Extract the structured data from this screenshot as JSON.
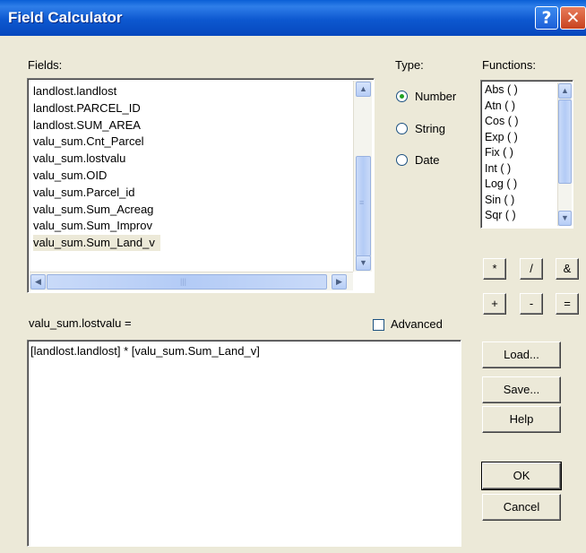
{
  "window": {
    "title": "Field Calculator"
  },
  "titlebar": {
    "help_glyph": "?",
    "close_glyph": "✕"
  },
  "fields": {
    "label": "Fields:",
    "items": [
      "landlost.landlost",
      "landlost.PARCEL_ID",
      "landlost.SUM_AREA",
      "valu_sum.Cnt_Parcel",
      "valu_sum.lostvalu",
      "valu_sum.OID",
      "valu_sum.Parcel_id",
      "valu_sum.Sum_Acreag",
      "valu_sum.Sum_Improv",
      "valu_sum.Sum_Land_v"
    ],
    "selected": "valu_sum.Sum_Land_v"
  },
  "type": {
    "label": "Type:",
    "options": [
      "Number",
      "String",
      "Date"
    ],
    "selected": "Number"
  },
  "functions": {
    "label": "Functions:",
    "items": [
      "Abs ( )",
      "Atn ( )",
      "Cos ( )",
      "Exp ( )",
      "Fix ( )",
      "Int ( )",
      "Log ( )",
      "Sin ( )",
      "Sqr ( )"
    ]
  },
  "operators": {
    "multiply": "*",
    "divide": "/",
    "ampersand": "&",
    "plus": "+",
    "minus": "-",
    "equals": "="
  },
  "expression": {
    "target_label": "valu_sum.lostvalu =",
    "value": "[landlost.landlost] * [valu_sum.Sum_Land_v]"
  },
  "advanced": {
    "label": "Advanced",
    "checked": false
  },
  "buttons": {
    "load": "Load...",
    "save": "Save...",
    "help": "Help",
    "ok": "OK",
    "cancel": "Cancel"
  },
  "colors": {
    "titlebar": "#0a5fd6",
    "dialog_bg": "#ece9d8",
    "close": "#c8421f"
  },
  "icons": {
    "scroll_up": "chevron-up-icon",
    "scroll_down": "chevron-down-icon",
    "scroll_left": "chevron-left-icon",
    "scroll_right": "chevron-right-icon"
  }
}
